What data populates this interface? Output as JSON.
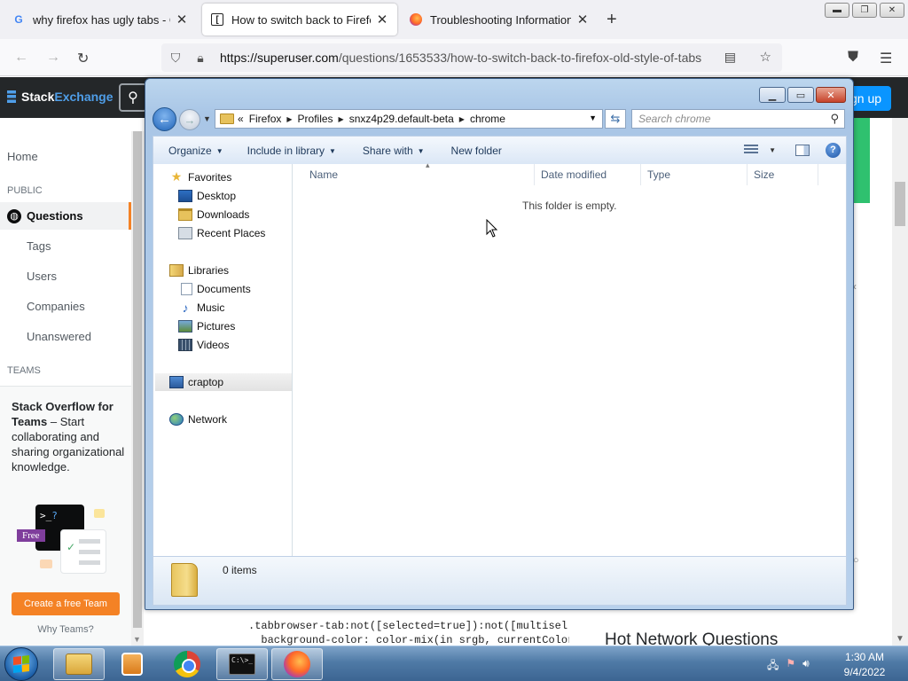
{
  "browser": {
    "tabs": [
      {
        "title": "why firefox has ugly tabs - Goo",
        "favicon": "google-icon"
      },
      {
        "title": "How to switch back to Firefox' o",
        "favicon": "superuser-icon"
      },
      {
        "title": "Troubleshooting Information",
        "favicon": "firefox-icon"
      }
    ],
    "url_domain": "https://superuser.com",
    "url_path": "/questions/1653533/how-to-switch-back-to-firefox-old-style-of-tabs"
  },
  "site": {
    "brand_stack": "Stack",
    "brand_exchange": "Exchange",
    "signup_label": "gn up",
    "nav": {
      "home": "Home",
      "public_caption": "PUBLIC",
      "questions": "Questions",
      "tags": "Tags",
      "users": "Users",
      "companies": "Companies",
      "unanswered": "Unanswered",
      "teams_caption": "TEAMS"
    },
    "teams": {
      "title": "Stack Overflow for Teams",
      "body": " – Start collaborating and sharing organizational knowledge.",
      "free_badge": "Free",
      "create_button": "Create a free Team",
      "why_link": "Why Teams?"
    },
    "code_line1": ".tabbrowser-tab:not([selected=true]):not([multisel",
    "code_line2": "  background-color: color-mix(in srgb, currentColor",
    "hot_network": "Hot Network Questions"
  },
  "explorer": {
    "breadcrumb": [
      "Firefox",
      "Profiles",
      "snxz4p29.default-beta",
      "chrome"
    ],
    "breadcrumb_overflow": "«",
    "search_placeholder": "Search chrome",
    "toolbar": {
      "organize": "Organize",
      "include_in_library": "Include in library",
      "share_with": "Share with",
      "new_folder": "New folder"
    },
    "nav": {
      "favorites": "Favorites",
      "desktop": "Desktop",
      "downloads": "Downloads",
      "recent_places": "Recent Places",
      "libraries": "Libraries",
      "documents": "Documents",
      "music": "Music",
      "pictures": "Pictures",
      "videos": "Videos",
      "computer": "craptop",
      "network": "Network"
    },
    "columns": {
      "name": "Name",
      "date_modified": "Date modified",
      "type": "Type",
      "size": "Size"
    },
    "empty_message": "This folder is empty.",
    "item_count": "0 items"
  },
  "taskbar": {
    "time": "1:30 AM",
    "date": "9/4/2022",
    "cmd_prompt_glyph": "C:\\>_"
  }
}
